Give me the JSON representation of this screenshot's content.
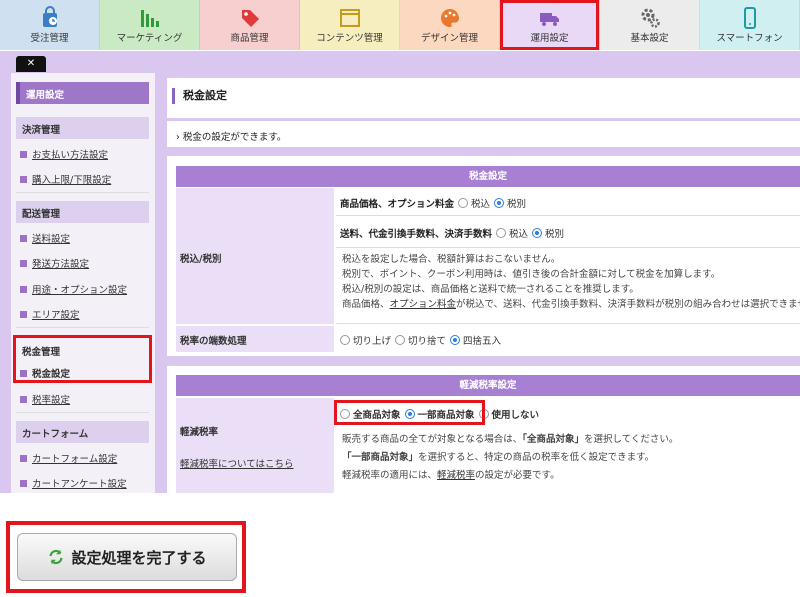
{
  "nav": {
    "tabs": [
      {
        "label": "受注管理",
        "icon": "order-bag-icon",
        "color": "#cfe1f1",
        "active": false
      },
      {
        "label": "マーケティング",
        "icon": "bar-chart-icon",
        "color": "#c9eac3",
        "active": false
      },
      {
        "label": "商品管理",
        "icon": "tag-icon",
        "color": "#f8cfcf",
        "active": false
      },
      {
        "label": "コンテンツ管理",
        "icon": "window-icon",
        "color": "#f6eebf",
        "active": false
      },
      {
        "label": "デザイン管理",
        "icon": "palette-icon",
        "color": "#fbd8bf",
        "active": false
      },
      {
        "label": "運用設定",
        "icon": "truck-icon",
        "color": "#e9d8f6",
        "active": true
      },
      {
        "label": "基本設定",
        "icon": "gears-icon",
        "color": "#ececec",
        "active": false
      },
      {
        "label": "スマートフォン",
        "icon": "smartphone-icon",
        "color": "#cfeff0",
        "active": false
      }
    ]
  },
  "sidebar": {
    "close_label": "✕",
    "top": "運用設定",
    "groups": [
      {
        "title": "決済管理",
        "items": [
          "お支払い方法設定",
          "購入上限/下限設定"
        ]
      },
      {
        "title": "配送管理",
        "items": [
          "送料設定",
          "発送方法設定",
          "用途・オプション設定",
          "エリア設定"
        ]
      },
      {
        "title": "税金管理",
        "items": [
          "税金設定",
          "税率設定"
        ]
      },
      {
        "title": "カートフォーム",
        "items": [
          "カートフォーム設定",
          "カートアンケート設定"
        ]
      }
    ]
  },
  "main": {
    "title": "税金設定",
    "description": "税金の設定ができます。",
    "tax_panel": {
      "header": "税金設定",
      "label_inclusive": "税込/税別",
      "row1_label": "商品価格、オプション料金",
      "row2_label": "送料、代金引換手数料、決済手数料",
      "opt_inclusive": "税込",
      "opt_exclusive": "税別",
      "notes": [
        "税込を設定した場合、税額計算はおこないません。",
        "税別で、ポイント、クーポン利用時は、値引き後の合計金額に対して税金を加算します。",
        "税込/税別の設定は、商品価格と送料で統一されることを推奨します。"
      ],
      "note4_prefix": "商品価格、",
      "note4_link": "オプション料金",
      "note4_suffix": "が税込で、送料、代金引換手数料、決済手数料が税別の組み合わせは選択できません。",
      "label_rounding": "税率の端数処理",
      "rounding_options": [
        "切り上げ",
        "切り捨て",
        "四捨五入"
      ],
      "rounding_selected": 2
    },
    "reduced_panel": {
      "header": "軽減税率設定",
      "label": "軽減税率",
      "link": "軽減税率についてはこちら",
      "options": [
        "全商品対象",
        "一部商品対象",
        "使用しない"
      ],
      "selected": 1,
      "note1_prefix": "販売する商品の全てが対象となる場合は、",
      "note1_bold": "「全商品対象」",
      "note1_suffix": "を選択してください。",
      "note2_bold": "「一部商品対象」",
      "note2_suffix": "を選択すると、特定の商品の税率を低く設定できます。",
      "note3_prefix": "軽減税率の適用には、",
      "note3_link": "軽減税率",
      "note3_suffix": "の設定が必要です。"
    }
  },
  "footer": {
    "submit_label": "設定処理を完了する",
    "submit_icon": "refresh-icon"
  },
  "colors": {
    "accent_purple": "#a77fd3",
    "highlight_red": "#e3141c",
    "radio_blue": "#2a7de1"
  }
}
